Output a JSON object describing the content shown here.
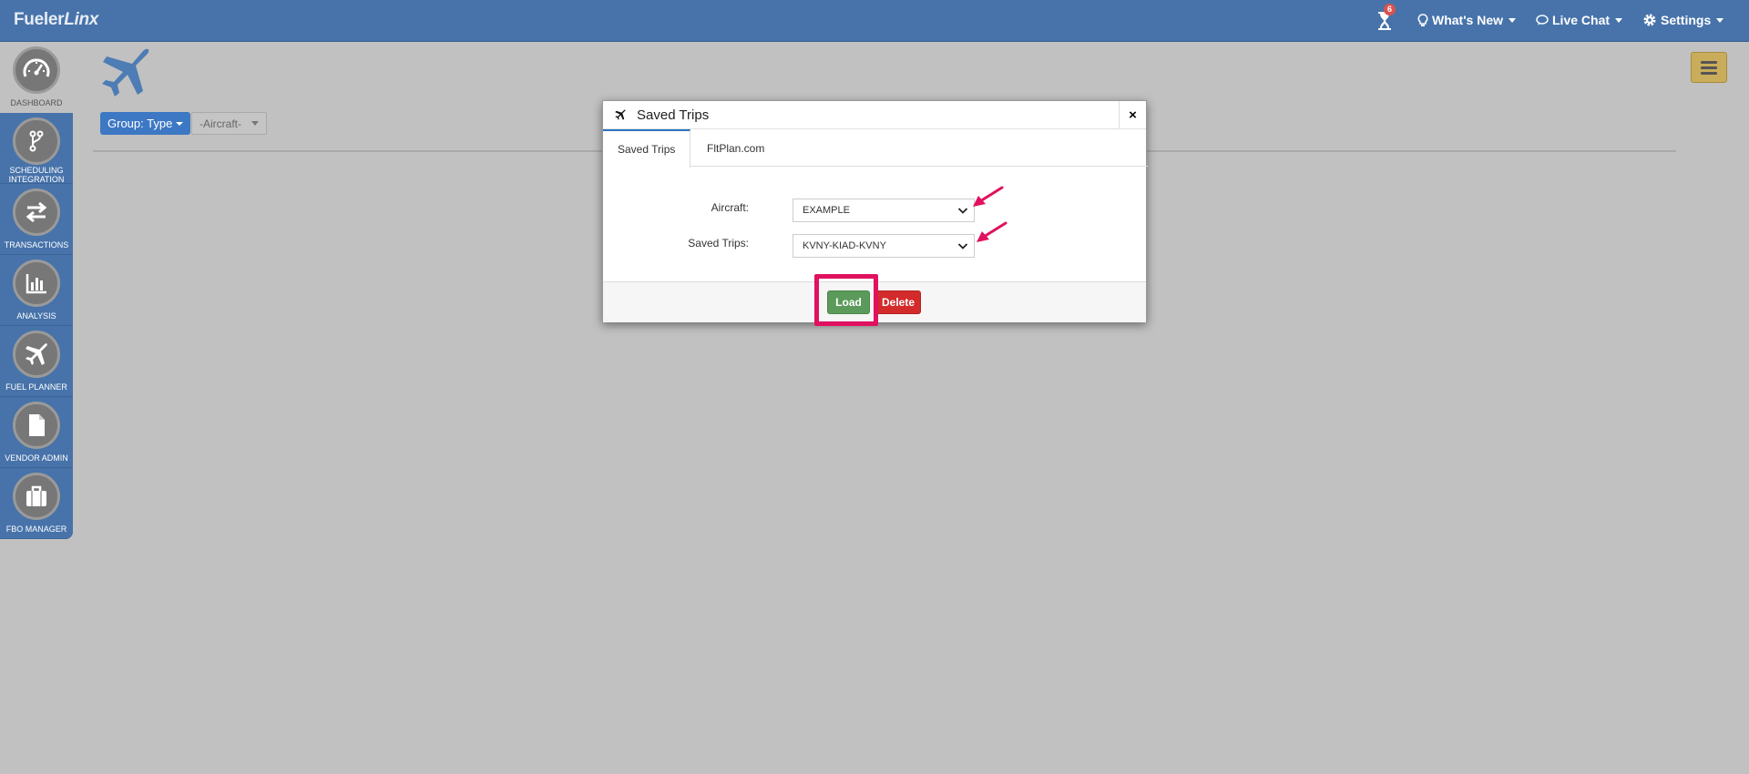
{
  "app": {
    "logo_primary": "Fueler",
    "logo_secondary": "Linx"
  },
  "topnav": {
    "notifications_count": "6",
    "whats_new": "What's New",
    "live_chat": "Live Chat",
    "settings": "Settings"
  },
  "sidebar": {
    "items": [
      {
        "label": "DASHBOARD",
        "icon": "gauge-icon"
      },
      {
        "label": "SCHEDULING INTEGRATION",
        "icon": "branch-icon"
      },
      {
        "label": "TRANSACTIONS",
        "icon": "swap-arrows-icon"
      },
      {
        "label": "ANALYSIS",
        "icon": "bar-chart-icon"
      },
      {
        "label": "FUEL PLANNER",
        "icon": "plane-icon"
      },
      {
        "label": "VENDOR ADMIN",
        "icon": "document-icon"
      },
      {
        "label": "FBO MANAGER",
        "icon": "briefcase-icon"
      }
    ]
  },
  "toolbar": {
    "group_button": "Group: Type",
    "aircraft_filter": "-Aircraft-"
  },
  "modal": {
    "title": "Saved Trips",
    "close": "×",
    "tabs": [
      {
        "label": "Saved Trips",
        "active": true
      },
      {
        "label": "FltPlan.com",
        "active": false
      }
    ],
    "aircraft_label": "Aircraft:",
    "aircraft_value": "EXAMPLE",
    "saved_trips_label": "Saved Trips:",
    "saved_trips_value": "KVNY-KIAD-KVNY",
    "load_button": "Load",
    "delete_button": "Delete"
  },
  "colors": {
    "nav_blue": "#4773aa",
    "load_green": "#5b9a5b",
    "delete_red": "#d32b2b",
    "annotation_pink": "#e0115f"
  }
}
